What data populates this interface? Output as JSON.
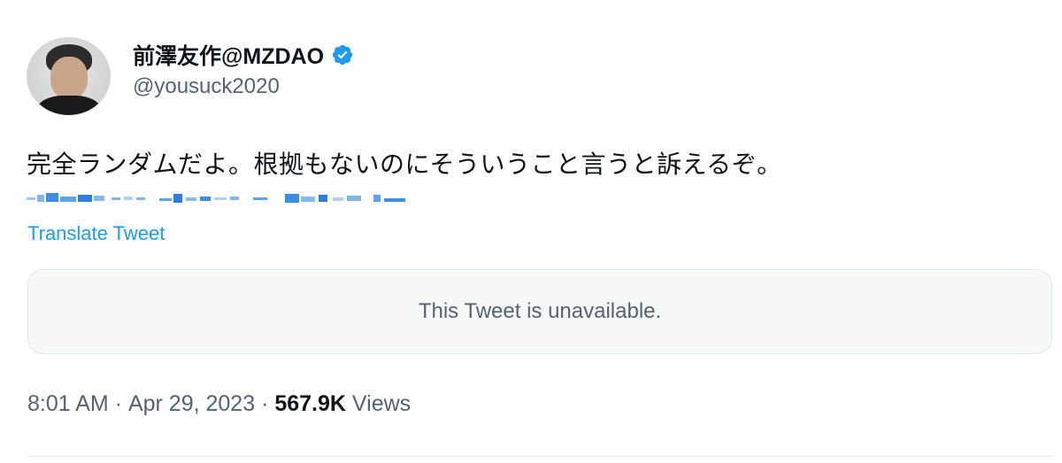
{
  "user": {
    "display_name": "前澤友作@MZDAO",
    "handle": "@yousuck2020",
    "verified_icon": "verified-badge-icon",
    "accent_color": "#1d9bf0"
  },
  "tweet": {
    "text": "完全ランダムだよ。根拠もないのにそういうこと言うと訴えるぞ。",
    "translate_label": "Translate Tweet",
    "quoted_tweet_message": "This Tweet is unavailable."
  },
  "meta": {
    "time": "8:01 AM",
    "separator": " · ",
    "date": "Apr 29, 2023",
    "views_count": "567.9K",
    "views_label": "Views"
  }
}
